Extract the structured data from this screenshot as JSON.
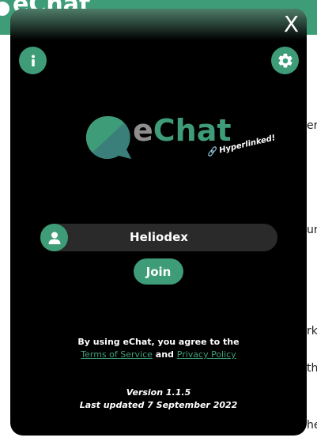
{
  "background": {
    "title": "eChat",
    "fragments": [
      "er",
      "ur",
      "rk",
      "th",
      "he"
    ]
  },
  "modal": {
    "close_label": "X",
    "icons": {
      "info": "info-icon",
      "settings": "gear-icon",
      "user": "user-icon",
      "link": "link-icon"
    },
    "logo": {
      "e": "e",
      "chat": "Chat",
      "badge": "Hyperlinked!"
    },
    "username": "Heliodex",
    "join_label": "Join",
    "legal": {
      "prefix": "By using eChat, you agree to the",
      "terms": "Terms of Service",
      "and": "and",
      "privacy": "Privacy Policy"
    },
    "version": "Version 1.1.5",
    "last_updated": "Last updated 7 September 2022"
  },
  "colors": {
    "accent": "#3e9d78",
    "modal_bg": "#000000",
    "field_bg": "#2a2a2a"
  }
}
